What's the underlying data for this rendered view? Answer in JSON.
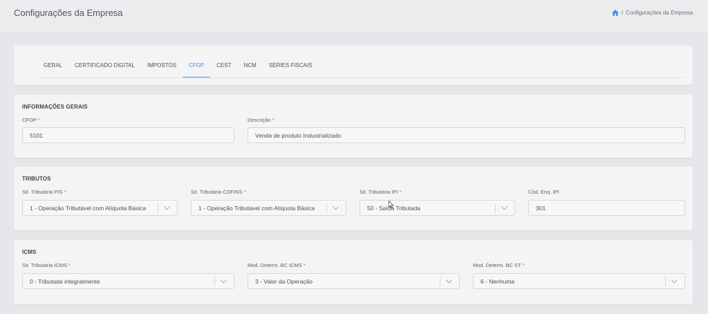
{
  "header": {
    "title": "Configurações da Empresa",
    "breadcrumb": {
      "separator": "/",
      "current": "Configurações da Empresa"
    }
  },
  "tabs": [
    {
      "label": "GERAL"
    },
    {
      "label": "CERTIFICADO DIGITAL"
    },
    {
      "label": "IMPOSTOS"
    },
    {
      "label": "CFOP"
    },
    {
      "label": "CEST"
    },
    {
      "label": "NCM"
    },
    {
      "label": "SÉRIES FISCAIS"
    }
  ],
  "active_tab": "CFOP",
  "info": {
    "title": "INFORMAÇÕES GERAIS",
    "cfop_label": "CFOP",
    "cfop_value": "5101",
    "descricao_label": "Descrição",
    "descricao_value": "Venda de produto Industrializado"
  },
  "tributos": {
    "title": "TRIBUTOS",
    "pis_label": "Sit. Tributária PIS",
    "pis_value": "1 - Operação Tributável com Alíquota Básica",
    "cofins_label": "Sit. Tributária COFINS",
    "cofins_value": "1 - Operação Tributável com Alíquota Básica",
    "ipi_label": "Sit. Tributária IPI",
    "ipi_value": "50 - Saída Tributada",
    "enq_label": "Cód. Enq. IPI",
    "enq_value": "301"
  },
  "icms": {
    "title": "ICMS",
    "sit_label": "Sit. Tributária ICMS",
    "sit_value": "0 - Tributada integralmente",
    "bc_label": "Mod. Determ. BC ICMS",
    "bc_value": "3 - Valor da Operação",
    "bcst_label": "Mod. Determ. BC ST",
    "bcst_value": "6 - Nenhuma"
  },
  "required_marker": "*",
  "colors": {
    "accent": "#4a90e2",
    "required": "#e35d5d"
  }
}
